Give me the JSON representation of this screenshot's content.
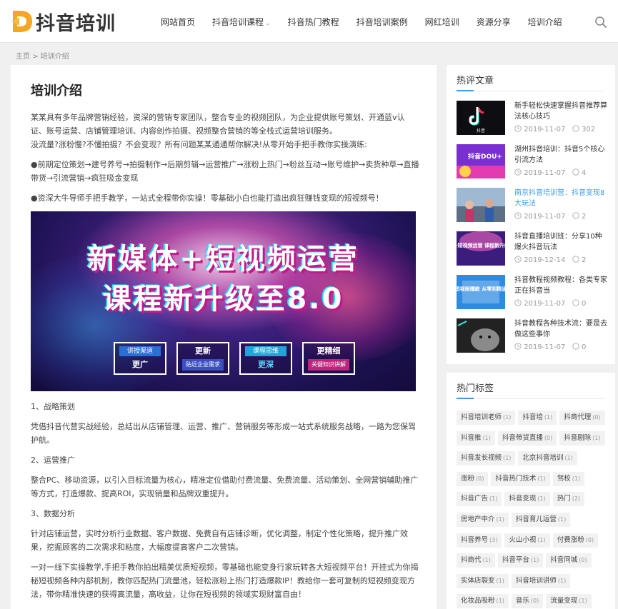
{
  "site": {
    "logo_text": "抖音培训",
    "accent": "#3d9be9",
    "logo_color": "#f5a623"
  },
  "nav": {
    "items": [
      {
        "label": "网站首页"
      },
      {
        "label": "抖音培训课程",
        "has_dropdown": true
      },
      {
        "label": "抖音热门教程"
      },
      {
        "label": "抖音培训案例"
      },
      {
        "label": "网红培训"
      },
      {
        "label": "资源分享"
      },
      {
        "label": "培训介绍"
      }
    ]
  },
  "breadcrumb": {
    "home": "主页",
    "separator": ">",
    "current": "培训介绍"
  },
  "article": {
    "title": "培训介绍",
    "para1": "某某具有多年品牌营销经验，资深的营销专家团队，整合专业的视频团队，为企业提供账号策划、开通蓝v认证、账号运营、店铺管理培训、内容创作拍摄、视频整合营销的等全栈式运营培训服务。",
    "para2": "没流量?涨粉慢?不懂拍摄？不会变现？所有问题某某通通帮你解决!从零开始手把手教你实操演练:",
    "para3": "●前期定位策划→建号养号→拍摄制作→后期剪辑→运营推广→涨粉上热门→粉丝互动→账号维护→卖货种草→直播带货→引流营销→疯狂吸金变现",
    "para4": "●资深大牛导师手把手教学，一站式全程带你实操！零基础小白也能打造出疯狂赚钱变现的短视频号！",
    "banner": {
      "line1": "新媒体+短视频运营",
      "line2": "课程新升级至8.0",
      "boxes": [
        {
          "top": "讲授渠道",
          "bottom": "更广"
        },
        {
          "top": "更新",
          "bottom": "贴近企业需求"
        },
        {
          "top": "课程思维",
          "bottom": "更深"
        },
        {
          "top": "更精细",
          "bottom": "关键知识讲解"
        }
      ]
    },
    "section1_heading": "1、战略策划",
    "section1_text": "凭借抖音代营实战经验，总结出从店铺管理、运营、推广、营销服务等形成一站式系统服务战略，一路为您保驾护航。",
    "section2_heading": "2、运营推广",
    "section2_text": "整合PC、移动资源，以引入目标流量为核心，精准定位借助付费流量、免费流量、活动策划、全网营销辅助推广等方式，打造爆款、提高ROI，实现销量和品牌双重提升。",
    "section3_heading": "3、数据分析",
    "section3_text": "针对店铺运营，实时分析行业数据、客户数据、免费自有店铺诊断，优化调整，制定个性化策略，提升推广效果，挖掘顾客的二次需求和粘度，大幅度提高客户二次营销。",
    "para_last": "一对一线下实操教学,手把手教你拍出精美优质短视频，零基础也能变身行家玩转各大短视频平台！开挂式为你揭秘短视频各种内部机制，教你匹配热门流量池，轻松涨粉上热门打造爆款IP！教给你一套可复制的短视频变现方法，带你精准快速的获得高流量，高收益，让你在短视频的领域实现财富自由！"
  },
  "hot_articles": {
    "title": "热评文章",
    "items": [
      {
        "title": "新手轻松快速掌握抖音推荐算法核心技巧",
        "date": "2019-11-07",
        "comments": "302",
        "thumb_text": "抖音"
      },
      {
        "title": "湖州抖音培训：抖音5个核心引流方法",
        "date": "2019-11-07",
        "comments": "4",
        "thumb_text": "抖音DOU+"
      },
      {
        "title": "南京抖音培训营：抖音变现8大玩法",
        "date": "2019-11-07",
        "comments": "2",
        "thumb_text": ""
      },
      {
        "title": "抖音直播培训班：分享10种爆火抖音玩法",
        "date": "2019-12-14",
        "comments": "2",
        "thumb_text": "新媒体+短视频运营 课程新升级至8.0"
      },
      {
        "title": "抖音教程视频教程：各类专家正在抖音当",
        "date": "2019-11-07",
        "comments": "0",
        "thumb_text": "短视频爆款 从零到精通"
      },
      {
        "title": "抖音教程各种技术流：要是去做这些事你",
        "date": "2019-11-07",
        "comments": "0",
        "thumb_text": ""
      }
    ]
  },
  "hot_tags": {
    "title": "热门标签",
    "items": [
      {
        "name": "抖音培训老师",
        "count": "(1)"
      },
      {
        "name": "抖音培",
        "count": "(1)"
      },
      {
        "name": "抖商代理",
        "count": "(0)"
      },
      {
        "name": "抖音推",
        "count": "(1)"
      },
      {
        "name": "抖音带货直播",
        "count": "(0)"
      },
      {
        "name": "抖音剧除",
        "count": "(1)"
      },
      {
        "name": "抖音发长视频",
        "count": "(1)"
      },
      {
        "name": "北京抖音培训",
        "count": "(1)"
      },
      {
        "name": "涨粉",
        "count": "(0)"
      },
      {
        "name": "抖音热门技术",
        "count": "(1)"
      },
      {
        "name": "驾校",
        "count": "(1)"
      },
      {
        "name": "抖音广告",
        "count": "(1)"
      },
      {
        "name": "抖音变现",
        "count": "(1)"
      },
      {
        "name": "热门",
        "count": "(2)"
      },
      {
        "name": "房地产中介",
        "count": "(1)"
      },
      {
        "name": "抖音育儿运营",
        "count": "(1)"
      },
      {
        "name": "抖音养号",
        "count": "(3)"
      },
      {
        "name": "火山小视",
        "count": "(1)"
      },
      {
        "name": "付费涨粉",
        "count": "(0)"
      },
      {
        "name": "抖商代",
        "count": "(1)"
      },
      {
        "name": "抖音平台",
        "count": "(1)"
      },
      {
        "name": "抖音同城",
        "count": "(0)"
      },
      {
        "name": "实体店裂变",
        "count": "(1)"
      },
      {
        "name": "抖音培训讲师",
        "count": "(1)"
      },
      {
        "name": "化妆品吸粉",
        "count": "(1)"
      },
      {
        "name": "音乐",
        "count": "(0)"
      },
      {
        "name": "流量变现",
        "count": "(1)"
      }
    ]
  }
}
